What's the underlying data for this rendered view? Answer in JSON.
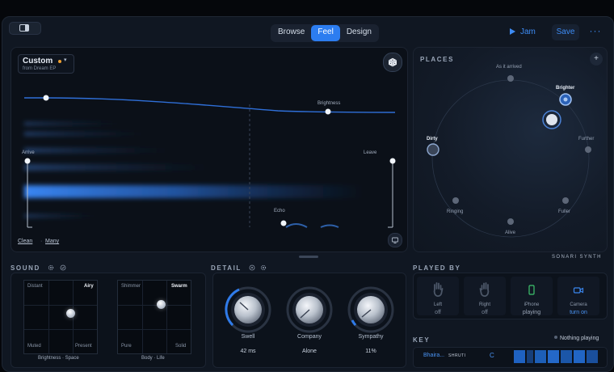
{
  "toolbar": {
    "tabs": [
      {
        "label": "Browse",
        "active": false
      },
      {
        "label": "Feel",
        "active": true
      },
      {
        "label": "Design",
        "active": false
      }
    ],
    "jam_label": "Jam",
    "save_label": "Save",
    "more_label": "···"
  },
  "feel": {
    "preset_name": "Custom",
    "preset_source": "from Dream EP",
    "labels": {
      "arrive": "Arrive",
      "leave": "Leave",
      "brightness": "Brightness",
      "echo": "Echo"
    },
    "clean_label": "Clean",
    "separator": "·",
    "many_label": "Many"
  },
  "places": {
    "title": "PLACES",
    "add_label": "+",
    "points": [
      {
        "label": "As it arrived",
        "emphasis": false
      },
      {
        "label": "Brighter",
        "emphasis": true
      },
      {
        "label": "Further",
        "emphasis": false
      },
      {
        "label": "Fuller",
        "emphasis": false
      },
      {
        "label": "Alive",
        "emphasis": false
      },
      {
        "label": "Ringing",
        "emphasis": false
      },
      {
        "label": "Dirty",
        "emphasis": true
      }
    ]
  },
  "brand": "SONARI SYNTH",
  "sound": {
    "title": "SOUND",
    "pad1": {
      "top_left": "Distant",
      "top_right": "Airy",
      "bottom_left": "Muted",
      "bottom_right": "Present",
      "caption": "Brightness · Space"
    },
    "pad2": {
      "top_left": "Shimmer",
      "top_right": "Swarm",
      "bottom_left": "Pure",
      "bottom_right": "Solid",
      "caption": "Body · Life"
    }
  },
  "detail": {
    "title": "DETAIL",
    "knobs": [
      {
        "name": "Swell",
        "value": "42 ms"
      },
      {
        "name": "Company",
        "value": "Alone"
      },
      {
        "name": "Sympathy",
        "value": "11%"
      }
    ]
  },
  "played_by": {
    "title": "PLAYED BY",
    "sources": [
      {
        "name": "Left",
        "status": "off"
      },
      {
        "name": "Right",
        "status": "off"
      },
      {
        "name": "iPhone",
        "status": "playing"
      },
      {
        "name": "Camera",
        "status": "turn on"
      }
    ]
  },
  "key": {
    "title": "KEY",
    "status": "Nothing playing",
    "raga": "Bhaira...",
    "shruti": "SHRUTI",
    "note": "C"
  },
  "colors": {
    "accent": "#2c7df0",
    "link": "#4a94f5",
    "panel": "#0c121b",
    "background": "#101722"
  }
}
